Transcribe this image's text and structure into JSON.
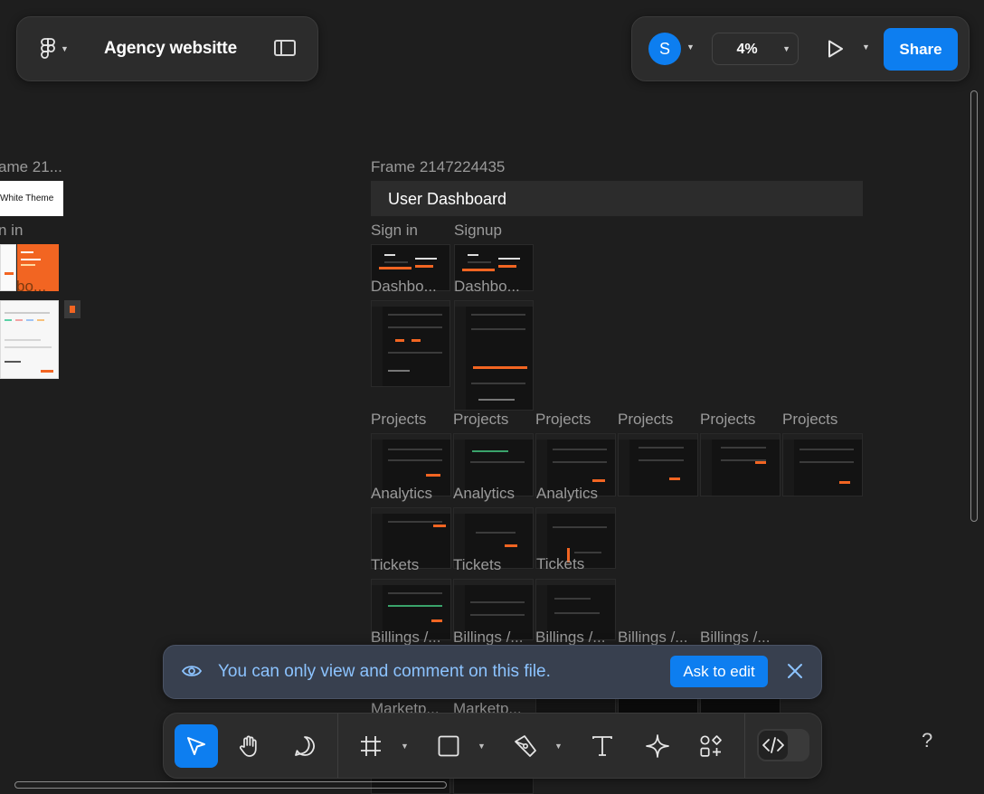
{
  "header": {
    "file_title": "Agency websitte",
    "user_initial": "S",
    "zoom": "4%",
    "share_label": "Share"
  },
  "canvas": {
    "left_frame_label": "ame 21...",
    "left_theme_label": "White Theme",
    "left_signin_label": "n in",
    "left_dashboard_label": "bo...",
    "frame_title": "Frame 2147224435",
    "section_header": "User Dashboard",
    "signin_label": "Sign in",
    "signup_label": "Signup",
    "dashboard_labels": [
      "Dashbo...",
      "Dashbo..."
    ],
    "projects_labels": [
      "Projects",
      "Projects",
      "Projects",
      "Projects",
      "Projects",
      "Projects"
    ],
    "analytics_labels": [
      "Analytics",
      "Analytics",
      "Analytics"
    ],
    "tickets_labels": [
      "Tickets",
      "Tickets",
      "Tickets"
    ],
    "billings_labels": [
      "Billings /...",
      "Billings /...",
      "Billings /...",
      "Billings /...",
      "Billings /..."
    ],
    "marketplace_labels": [
      "Marketp...",
      "Marketp..."
    ]
  },
  "banner": {
    "message": "You can only view and comment on this file.",
    "ask_label": "Ask to edit"
  },
  "toolbar": {
    "tools": [
      "move-tool",
      "hand-tool",
      "comment-tool",
      "frame-tool",
      "shape-tool",
      "pen-tool",
      "text-tool",
      "component-tool",
      "assets-tool",
      "dev-mode-toggle"
    ]
  },
  "help": "?",
  "colors": {
    "accent": "#0d7ef0",
    "brand_orange": "#f26522",
    "canvas": "#1e1e1e",
    "panel": "#2c2c2c"
  }
}
